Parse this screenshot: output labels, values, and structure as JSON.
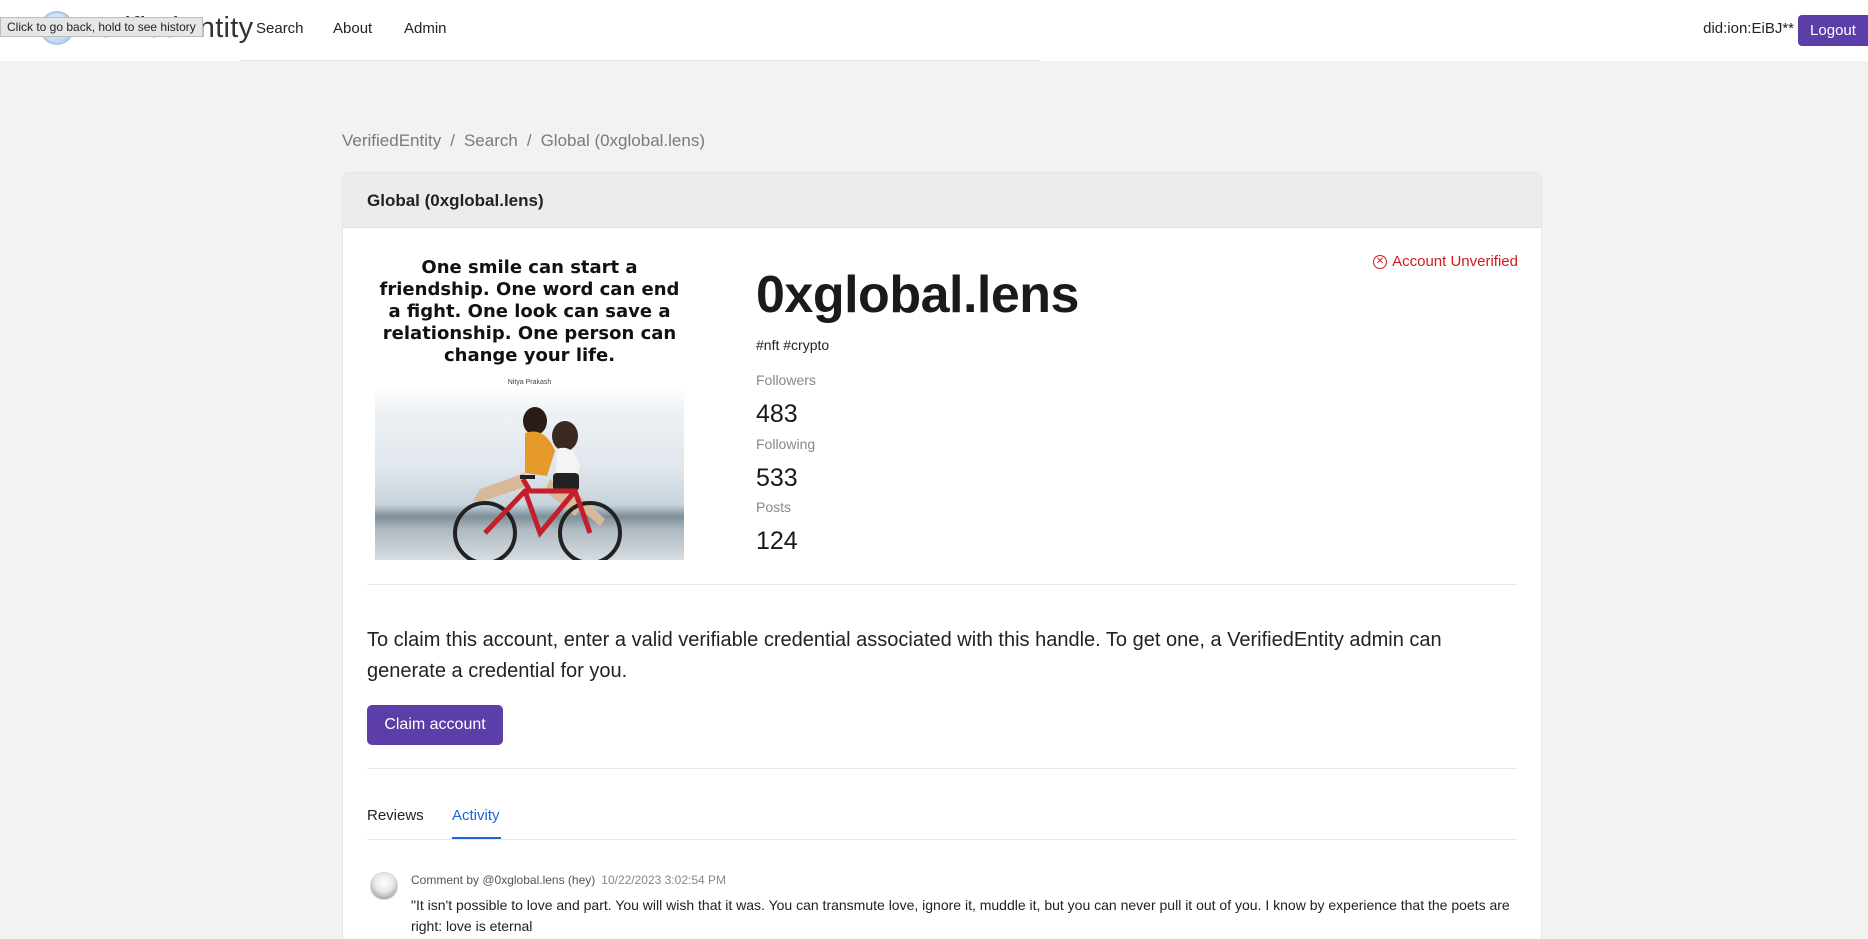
{
  "nav": {
    "brand": "VerifiedEntity",
    "tooltip": "Click to go back, hold to see history",
    "links": [
      "Search",
      "About",
      "Admin"
    ],
    "did": "did:ion:EiBJ**",
    "logout": "Logout"
  },
  "breadcrumb": [
    "VerifiedEntity",
    "Search",
    "Global (0xglobal.lens)"
  ],
  "card": {
    "header": "Global (0xglobal.lens)",
    "image": {
      "quote": "One smile can start a friendship. One word can end a fight. One look can save a relationship. One person can change your life.",
      "author": "Nitya Prakash"
    },
    "handle": "0xglobal.lens",
    "tags": "#nft #crypto",
    "status": "Account Unverified",
    "stats": [
      {
        "label": "Followers",
        "value": "483"
      },
      {
        "label": "Following",
        "value": "533"
      },
      {
        "label": "Posts",
        "value": "124"
      }
    ],
    "claim_text": "To claim this account, enter a valid verifiable credential associated with this handle. To get one, a VerifiedEntity admin can generate a credential for you.",
    "claim_button": "Claim account",
    "tabs": [
      {
        "label": "Reviews",
        "active": false
      },
      {
        "label": "Activity",
        "active": true
      }
    ],
    "activity": [
      {
        "meta": "Comment by @0xglobal.lens (hey)",
        "time": "10/22/2023 3:02:54 PM",
        "text": "\"It isn't possible to love and part. You will wish that it was. You can transmute love, ignore it, muddle it, but you can never pull it out of you. I know by experience that the poets are right: love is eternal"
      }
    ]
  },
  "colors": {
    "accent": "#5b3ea8",
    "link": "#1a66d6",
    "danger": "#d21a1a"
  }
}
